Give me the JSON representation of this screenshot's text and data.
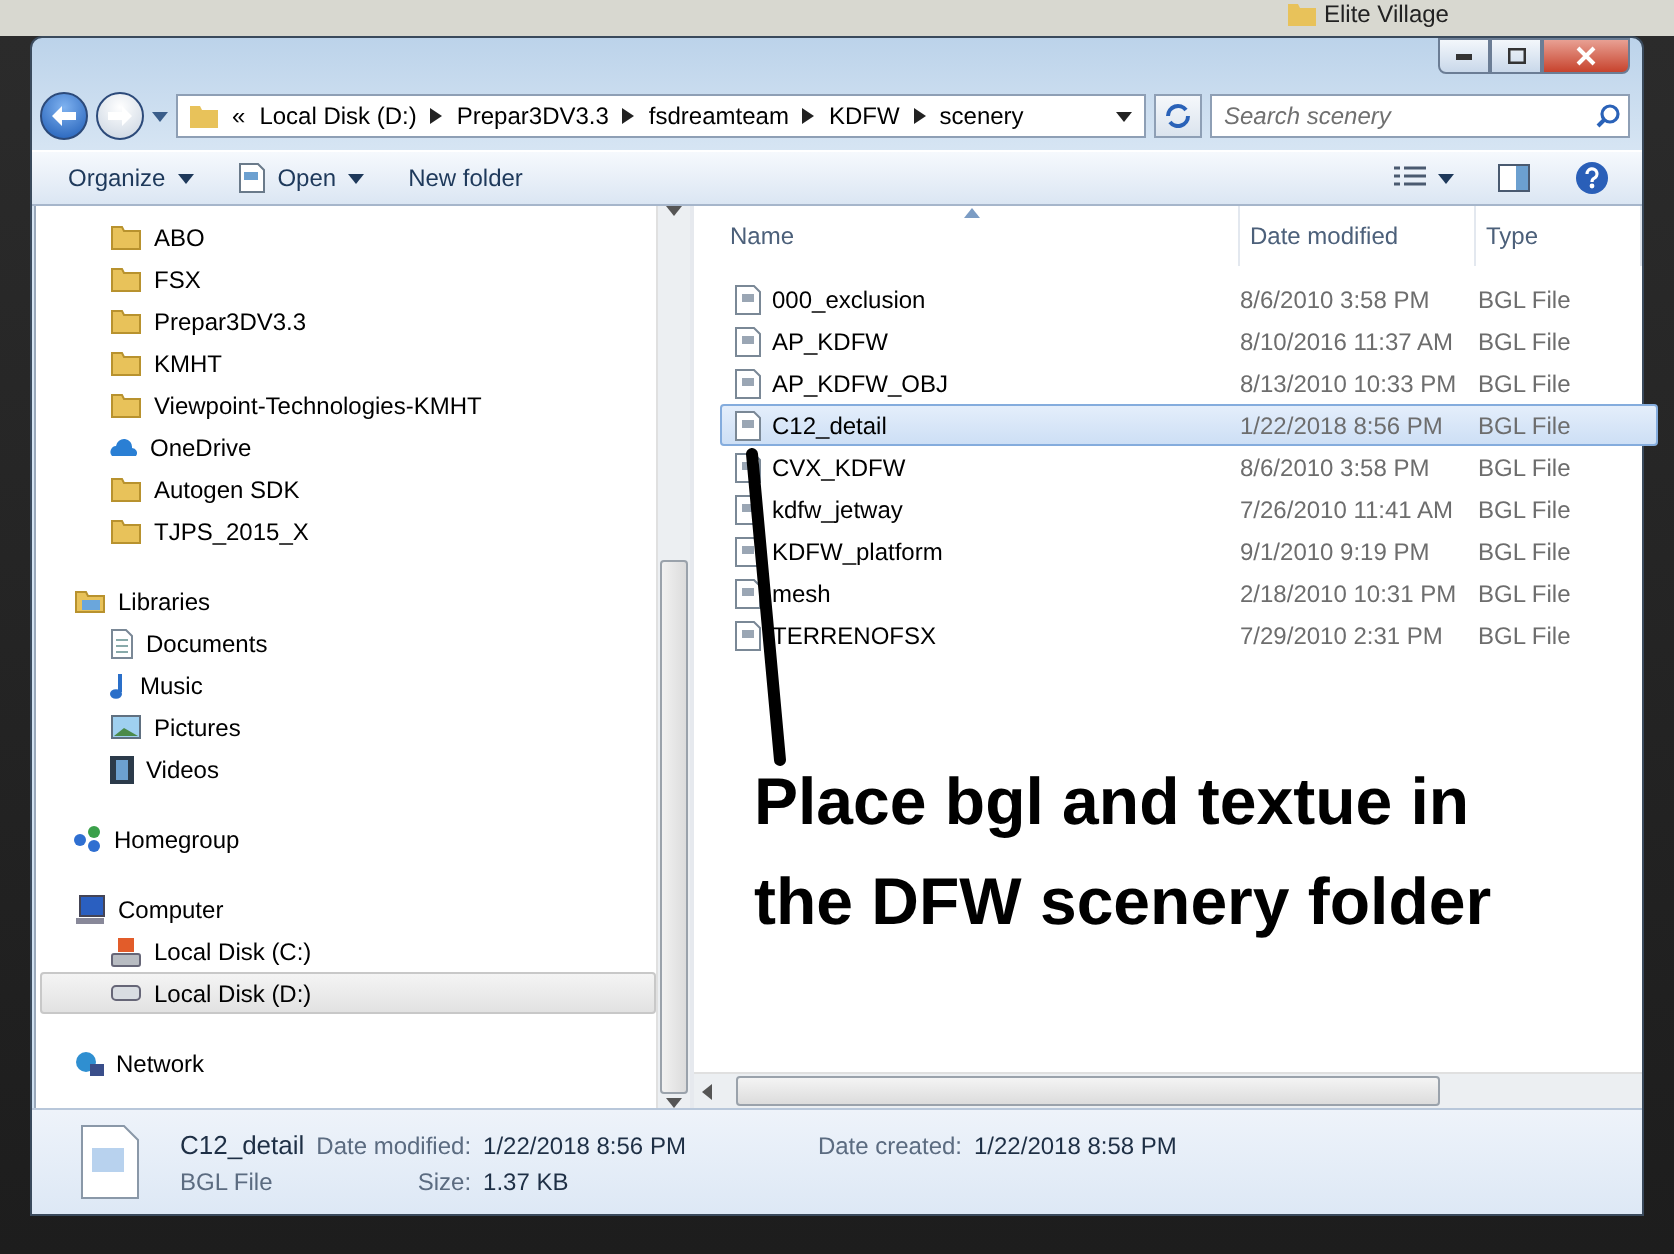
{
  "desktop": {
    "label": "Elite Village"
  },
  "address": {
    "overflow": "«",
    "path": [
      "Local Disk (D:)",
      "Prepar3DV3.3",
      "fsdreamteam",
      "KDFW",
      "scenery"
    ]
  },
  "search": {
    "placeholder": "Search scenery"
  },
  "toolbar": [
    {
      "label": "Organize",
      "kind": "menu"
    },
    {
      "label": "Open",
      "kind": "open"
    },
    {
      "label": "New folder",
      "kind": "plain"
    }
  ],
  "nav": [
    {
      "children": [
        {
          "label": "ABO",
          "kind": "folder",
          "selected": false
        },
        {
          "label": "FSX",
          "kind": "folder",
          "selected": false
        },
        {
          "label": "Prepar3DV3.3",
          "kind": "folder",
          "selected": false
        },
        {
          "label": "KMHT",
          "kind": "folder",
          "selected": false
        },
        {
          "label": "Viewpoint-Technologies-KMHT",
          "kind": "folder",
          "selected": false
        },
        {
          "label": "OneDrive",
          "kind": "cloud",
          "selected": false
        },
        {
          "label": "Autogen SDK",
          "kind": "folder",
          "selected": false
        },
        {
          "label": "TJPS_2015_X",
          "kind": "folder",
          "selected": false
        }
      ]
    },
    {
      "label": "Libraries",
      "kind": "library",
      "selected": false,
      "children": [
        {
          "label": "Documents",
          "kind": "document",
          "selected": false
        },
        {
          "label": "Music",
          "kind": "music",
          "selected": false
        },
        {
          "label": "Pictures",
          "kind": "picture",
          "selected": false
        },
        {
          "label": "Videos",
          "kind": "video",
          "selected": false
        }
      ]
    },
    {
      "label": "Homegroup",
      "kind": "homegroup",
      "selected": false
    },
    {
      "label": "Computer",
      "kind": "computer",
      "selected": false,
      "children": [
        {
          "label": "Local Disk (C:)",
          "kind": "system-drive",
          "selected": false
        },
        {
          "label": "Local Disk (D:)",
          "kind": "drive",
          "selected": true
        }
      ]
    },
    {
      "label": "Network",
      "kind": "network",
      "selected": false
    }
  ],
  "columns": [
    {
      "label": "Name",
      "sorted": true
    },
    {
      "label": "Date modified",
      "sorted": false
    },
    {
      "label": "Type",
      "sorted": false
    }
  ],
  "files": [
    {
      "name": "000_exclusion",
      "date": "8/6/2010 3:58 PM",
      "type": "BGL File",
      "selected": false
    },
    {
      "name": "AP_KDFW",
      "date": "8/10/2016 11:37 AM",
      "type": "BGL File",
      "selected": false
    },
    {
      "name": "AP_KDFW_OBJ",
      "date": "8/13/2010 10:33 PM",
      "type": "BGL File",
      "selected": false
    },
    {
      "name": "C12_detail",
      "date": "1/22/2018 8:56 PM",
      "type": "BGL File",
      "selected": true
    },
    {
      "name": "CVX_KDFW",
      "date": "8/6/2010 3:58 PM",
      "type": "BGL File",
      "selected": false
    },
    {
      "name": "kdfw_jetway",
      "date": "7/26/2010 11:41 AM",
      "type": "BGL File",
      "selected": false
    },
    {
      "name": "KDFW_platform",
      "date": "9/1/2010 9:19 PM",
      "type": "BGL File",
      "selected": false
    },
    {
      "name": "mesh",
      "date": "2/18/2010 10:31 PM",
      "type": "BGL File",
      "selected": false
    },
    {
      "name": "TERRENOFSX",
      "date": "7/29/2010 2:31 PM",
      "type": "BGL File",
      "selected": false
    }
  ],
  "annotation": {
    "text": "Place bgl and textue in the DFW scenery folder"
  },
  "details": {
    "name": "C12_detail",
    "type": "BGL File",
    "fields": [
      {
        "label": "Date modified:",
        "value": "1/22/2018 8:56 PM"
      },
      {
        "label": "Date created:",
        "value": "1/22/2018 8:58 PM"
      },
      {
        "label": "Size:",
        "value": "1.37 KB"
      }
    ]
  }
}
